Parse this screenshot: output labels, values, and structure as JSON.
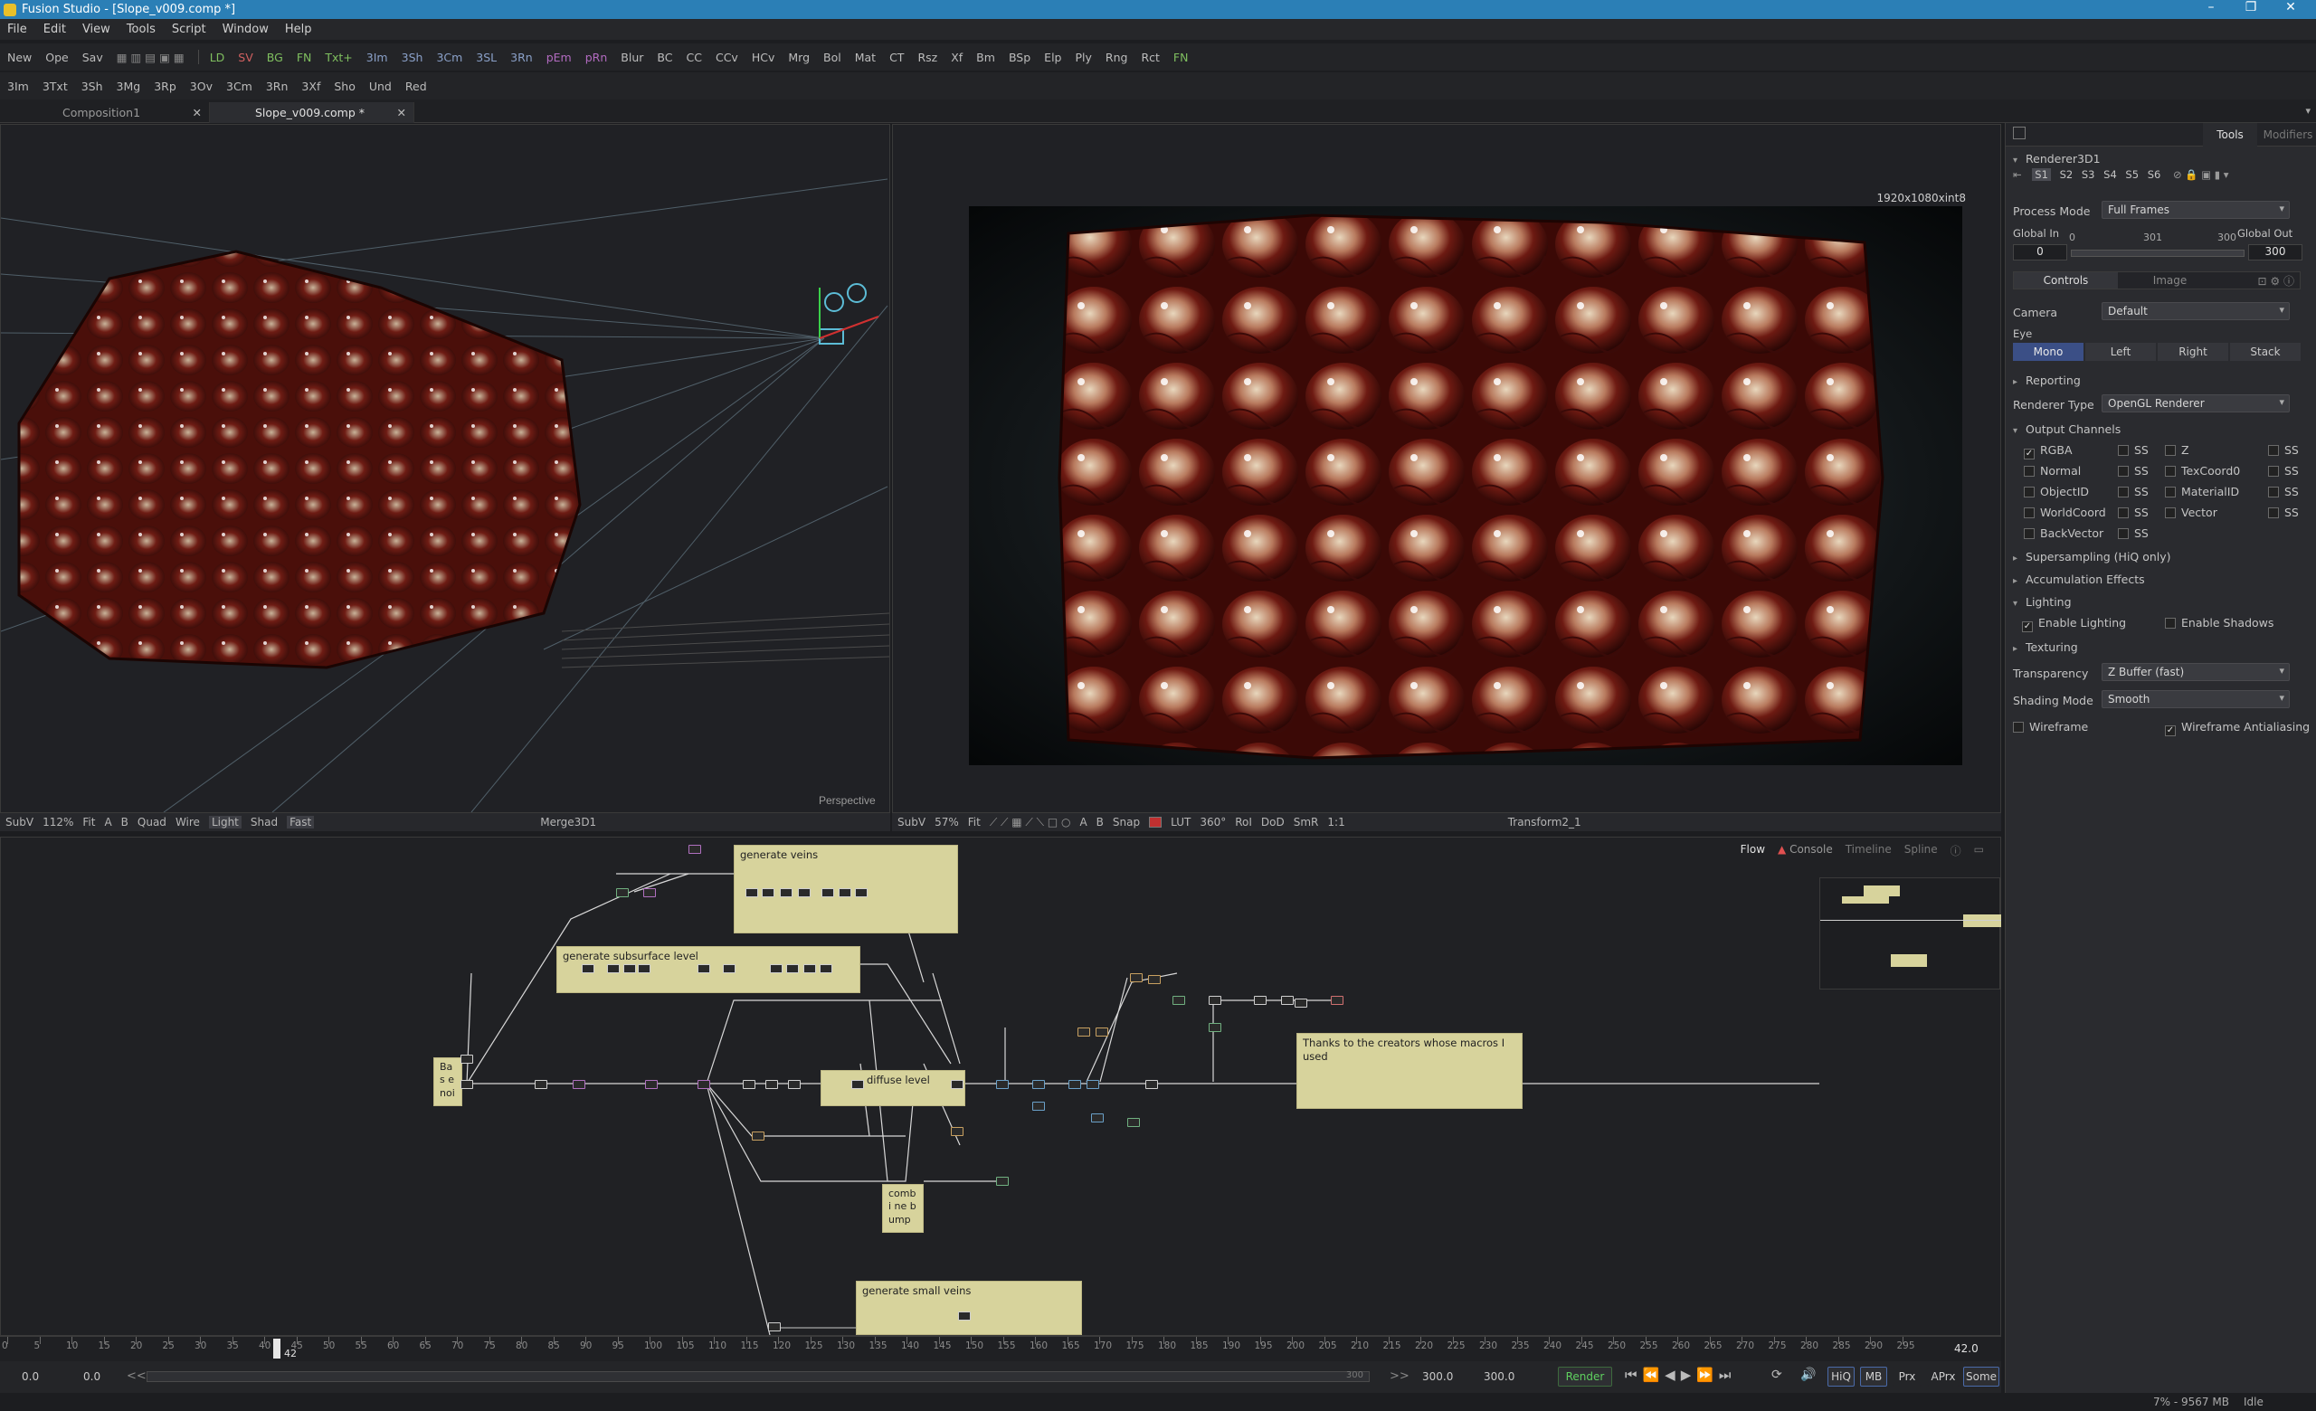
{
  "window": {
    "title": "Fusion Studio - [Slope_v009.comp *]"
  },
  "menu": [
    "File",
    "Edit",
    "View",
    "Tools",
    "Script",
    "Window",
    "Help"
  ],
  "toolbar1": [
    "New",
    "Ope",
    "Sav",
    "LD",
    "SV",
    "BG",
    "FN",
    "Txt+",
    "3Im",
    "3Sh",
    "3Cm",
    "3SL",
    "3Rn",
    "pEm",
    "pRn",
    "Blur",
    "BC",
    "CC",
    "CCv",
    "HCv",
    "Mrg",
    "Bol",
    "Mat",
    "CT",
    "Rsz",
    "Xf",
    "Bm",
    "BSp",
    "Elp",
    "Ply",
    "Rng",
    "Rct",
    "FN"
  ],
  "toolbar2": [
    "3Im",
    "3Txt",
    "3Sh",
    "3Mg",
    "3Rp",
    "3Ov",
    "3Cm",
    "3Rn",
    "3Xf",
    "Sho",
    "Und",
    "Red"
  ],
  "tabs": [
    {
      "label": "Composition1"
    },
    {
      "label": "Slope_v009.comp *"
    }
  ],
  "viewer_left": {
    "label": "Perspective",
    "bar": [
      "SubV",
      "112%",
      "Fit",
      "A",
      "B",
      "Quad",
      "Wire",
      "Light",
      "Shad",
      "Fast"
    ],
    "node": "Merge3D1"
  },
  "viewer_right": {
    "resolution": "1920x1080xint8",
    "bar": [
      "SubV",
      "57%",
      "Fit",
      "A",
      "B",
      "Snap",
      "LUT",
      "360°",
      "RoI",
      "DoD",
      "SmR",
      "1:1"
    ],
    "node": "Transform2_1"
  },
  "inspector": {
    "tabs": [
      "Tools",
      "Modifiers"
    ],
    "node": "Renderer3D1",
    "slots": [
      "S1",
      "S2",
      "S3",
      "S4",
      "S5",
      "S6"
    ],
    "process_mode_label": "Process Mode",
    "process_mode": "Full Frames",
    "global_in_label": "Global In",
    "global_out_label": "Global Out",
    "range_min": "0",
    "range_mid": "301",
    "range_max": "300",
    "global_in": "0",
    "global_out": "300",
    "subtabs": [
      "Controls",
      "Image"
    ],
    "camera_label": "Camera",
    "camera": "Default",
    "eye_label": "Eye",
    "eye_options": [
      "Mono",
      "Left",
      "Right",
      "Stack"
    ],
    "reporting": "Reporting",
    "renderer_type_label": "Renderer Type",
    "renderer_type": "OpenGL Renderer",
    "output_channels": "Output Channels",
    "channels": [
      {
        "name": "RGBA",
        "checked": true,
        "ss": "SS"
      },
      {
        "name": "Normal",
        "checked": false,
        "ss": "SS"
      },
      {
        "name": "ObjectID",
        "checked": false,
        "ss": "SS"
      },
      {
        "name": "WorldCoord",
        "checked": false,
        "ss": "SS"
      },
      {
        "name": "BackVector",
        "checked": false,
        "ss": "SS"
      }
    ],
    "channels2": [
      {
        "name": "Z",
        "ss": "SS"
      },
      {
        "name": "TexCoord0",
        "ss": "SS"
      },
      {
        "name": "MaterialID",
        "ss": "SS"
      },
      {
        "name": "Vector",
        "ss": "SS"
      }
    ],
    "supersampling": "Supersampling (HiQ only)",
    "accumulation": "Accumulation Effects",
    "lighting": "Lighting",
    "enable_lighting": "Enable Lighting",
    "enable_shadows": "Enable Shadows",
    "texturing": "Texturing",
    "transparency_label": "Transparency",
    "transparency": "Z Buffer (fast)",
    "shading_label": "Shading Mode",
    "shading": "Smooth",
    "wireframe": "Wireframe",
    "wireframe_aa": "Wireframe Antialiasing"
  },
  "flow": {
    "tabs": [
      "Flow",
      "Console",
      "Timeline",
      "Spline"
    ],
    "notes": [
      {
        "text": "generate veins"
      },
      {
        "text": "generate subsurface level"
      },
      {
        "text": "diffuse level"
      },
      {
        "text": "Thanks to the creators whose macros I used"
      },
      {
        "text": "Bas e noi"
      },
      {
        "text": "combi ne bump"
      },
      {
        "text": "generate small veins"
      }
    ]
  },
  "timeline": {
    "ticks": [
      "0",
      "5",
      "10",
      "15",
      "20",
      "25",
      "30",
      "35",
      "40",
      "45",
      "50",
      "55",
      "60",
      "65",
      "70",
      "75",
      "80",
      "85",
      "90",
      "95",
      "100",
      "105",
      "110",
      "115",
      "120",
      "125",
      "130",
      "135",
      "140",
      "145",
      "150",
      "155",
      "160",
      "165",
      "170",
      "175",
      "180",
      "185",
      "190",
      "195",
      "200",
      "205",
      "210",
      "215",
      "220",
      "225",
      "230",
      "235",
      "240",
      "245",
      "250",
      "255",
      "260",
      "265",
      "270",
      "275",
      "280",
      "285",
      "290",
      "295"
    ],
    "current": "42",
    "current_value": "42.0"
  },
  "transport": {
    "start": "0.0",
    "in": "0.0",
    "range_end": "300",
    "out": "300.0",
    "end": "300.0",
    "render": "Render",
    "modes": [
      "HiQ",
      "MB",
      "Prx",
      "APrx",
      "Some"
    ]
  },
  "status": {
    "memory": "7% - 9567 MB",
    "state": "Idle"
  },
  "colors": {
    "titlebar": "#2b7fb6",
    "accent": "#e8c02a",
    "note": "#d7d39c"
  }
}
